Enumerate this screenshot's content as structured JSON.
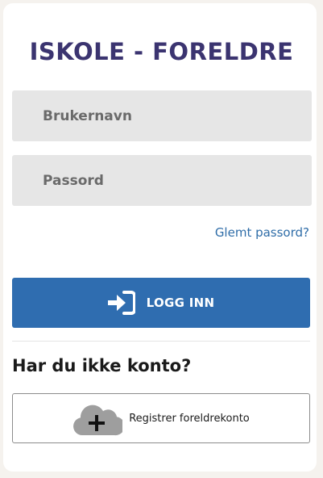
{
  "header": {
    "title": "ISKOLE - FORELDRE"
  },
  "form": {
    "username_placeholder": "Brukernavn",
    "password_placeholder": "Passord",
    "forgot_label": "Glemt passord?",
    "login_label": "LOGG INN",
    "login_icon": "sign-in-icon"
  },
  "register": {
    "heading": "Har du ikke konto?",
    "button_label": "Registrer foreldrekonto",
    "button_icon": "cloud-plus-icon"
  },
  "colors": {
    "title": "#3b3470",
    "primary_button": "#2f6db0",
    "link": "#2f6da8",
    "input_background": "#e6e6e6"
  }
}
